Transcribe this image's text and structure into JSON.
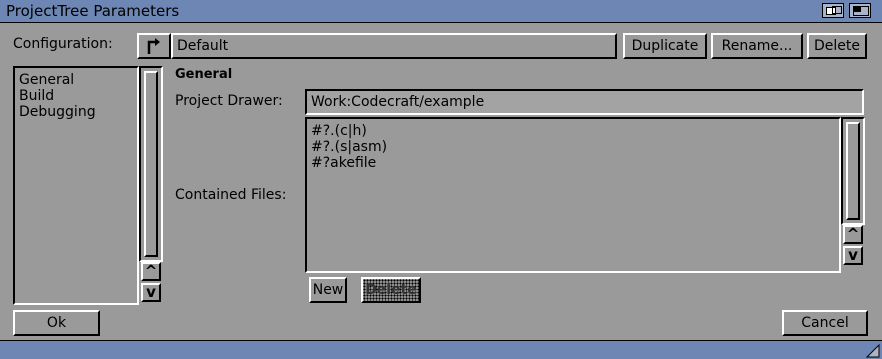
{
  "window": {
    "title": "ProjectTree Parameters"
  },
  "config": {
    "label": "Configuration:",
    "value": "Default",
    "duplicate_label": "Duplicate",
    "rename_label": "Rename...",
    "delete_label": "Delete"
  },
  "sections": [
    "General",
    "Build",
    "Debugging"
  ],
  "general": {
    "heading": "General",
    "drawer_label": "Project Drawer:",
    "drawer_value": "Work:Codecraft/example",
    "files_label": "Contained Files:",
    "files": [
      "#?.(c|h)",
      "#?.(s|asm)",
      "#?akefile"
    ],
    "new_label": "New",
    "delete_label": "Delete"
  },
  "footer": {
    "ok_label": "Ok",
    "cancel_label": "Cancel"
  },
  "icons": {
    "popup": "cycle-icon",
    "depth": "depth-gadget-icon",
    "zoom": "zoom-gadget-icon",
    "up": "arrow-up-icon",
    "down": "arrow-down-icon",
    "resize": "resize-icon"
  },
  "colors": {
    "titlebar": "#6d86b3",
    "panel": "#9a9a9a"
  }
}
